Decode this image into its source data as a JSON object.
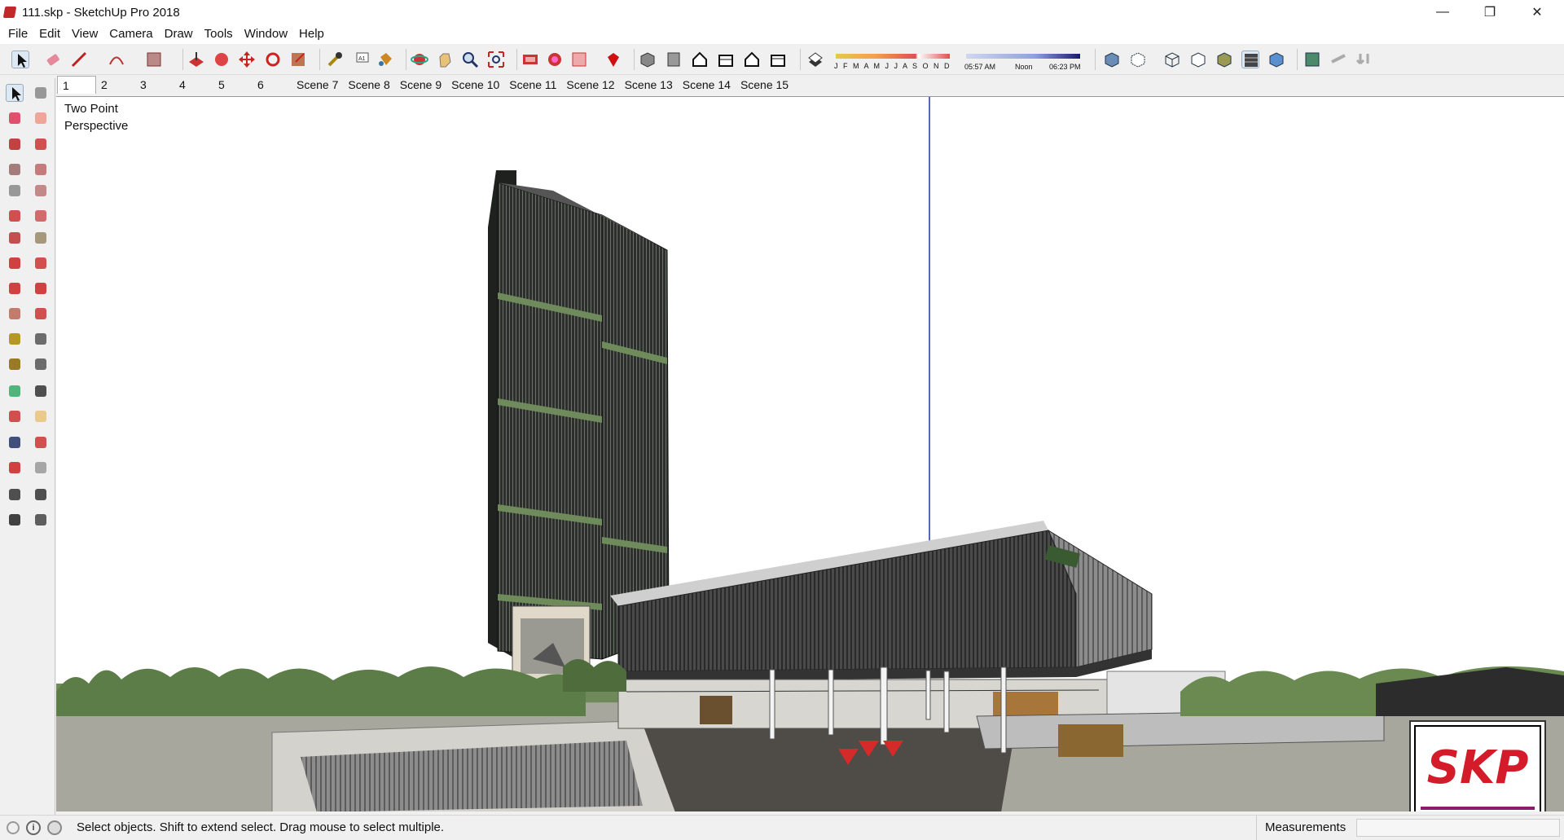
{
  "window": {
    "title": "111.skp - SketchUp Pro 2018"
  },
  "menu": [
    "File",
    "Edit",
    "View",
    "Camera",
    "Draw",
    "Tools",
    "Window",
    "Help"
  ],
  "shadow": {
    "months": "J F M A M J J A S O N D",
    "time_start": "05:57 AM",
    "time_mid": "Noon",
    "time_end": "06:23 PM"
  },
  "scenes": [
    "1",
    "2",
    "3",
    "4",
    "5",
    "6",
    "Scene 7",
    "Scene 8",
    "Scene 9",
    "Scene 10",
    "Scene 11",
    "Scene 12",
    "Scene 13",
    "Scene 14",
    "Scene 15"
  ],
  "viewport": {
    "camera_label": "Two Point\nPerspective",
    "logo_text": "SKP"
  },
  "status": {
    "hint": "Select objects. Shift to extend select. Drag mouse to select multiple.",
    "measurements_label": "Measurements",
    "measurements_value": ""
  },
  "toolbar_icons": [
    "select-icon",
    "eraser-icon",
    "line-icon",
    "arc-icon",
    "rectangle-icon",
    "push-pull-icon",
    "follow-me-icon",
    "move-icon",
    "rotate-icon",
    "scale-icon",
    "tape-measure-icon",
    "text-icon",
    "paint-bucket-icon",
    "orbit-icon",
    "pan-icon",
    "zoom-icon",
    "zoom-extents-icon",
    "warehouse-icon",
    "extension-warehouse-icon",
    "layout-icon",
    "ruby-icon",
    "iso-view-icon",
    "top-view-icon",
    "front-view-icon",
    "right-view-icon",
    "back-view-icon",
    "left-view-icon",
    "shadow-toggle-icon",
    "xray-icon",
    "back-edges-icon",
    "wireframe-icon",
    "hidden-line-icon",
    "shaded-icon",
    "shaded-textures-icon",
    "monochrome-icon",
    "match-photo-icon",
    "section-plane-icon",
    "section-cut-icon"
  ],
  "left_icons": [
    "select-icon",
    "component-icon",
    "paint-bucket-icon",
    "eraser-icon",
    "line-icon",
    "freehand-icon",
    "rectangle-icon",
    "rotated-rectangle-icon",
    "circle-icon",
    "polygon-icon",
    "arc-icon",
    "two-point-arc-icon",
    "three-point-arc-icon",
    "pie-icon",
    "move-icon",
    "push-pull-icon",
    "rotate-icon",
    "follow-me-icon",
    "scale-icon",
    "offset-icon",
    "tape-measure-icon",
    "dimension-icon",
    "protractor-icon",
    "text-icon",
    "axes-icon",
    "3d-text-icon",
    "orbit-icon",
    "pan-icon",
    "zoom-icon",
    "zoom-window-icon",
    "zoom-extents-icon",
    "previous-view-icon",
    "position-camera-icon",
    "look-around-icon",
    "walk-icon",
    "section-plane-icon"
  ]
}
